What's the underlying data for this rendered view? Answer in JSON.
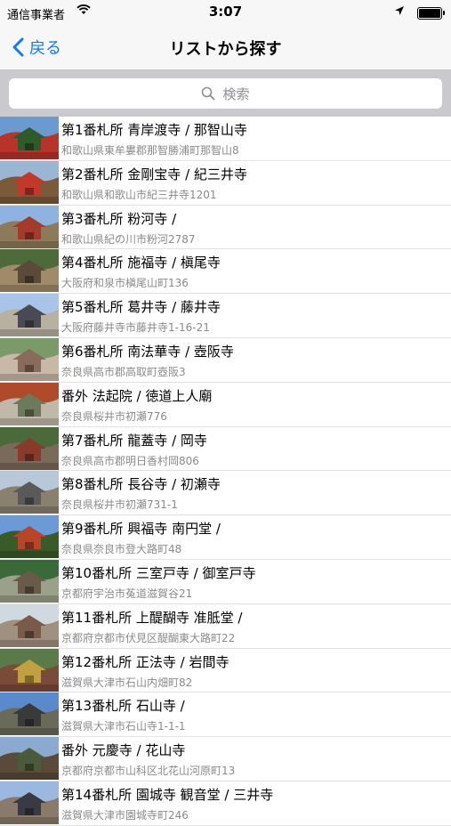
{
  "status_bar": {
    "carrier": "通信事業者",
    "time": "3:07"
  },
  "nav": {
    "back_label": "戻る",
    "title": "リストから探す"
  },
  "search": {
    "placeholder": "検索"
  },
  "colors": {
    "accent": "#0a7aff",
    "subtitle": "#8a8a8a",
    "search_bg": "#c9c9ce"
  },
  "temples": [
    {
      "name": "第1番札所 青岸渡寺 / 那智山寺",
      "address": "和歌山県東牟婁郡那智勝浦町那智山8",
      "thumb": [
        "#6a9bd0",
        "#2f5a2a",
        "#b8342a"
      ]
    },
    {
      "name": "第2番札所 金剛宝寺 / 紀三井寺",
      "address": "和歌山県和歌山市紀三井寺1201",
      "thumb": [
        "#9bb5d4",
        "#c0392b",
        "#7a5a3a"
      ]
    },
    {
      "name": "第3番札所 粉河寺 /",
      "address": "和歌山県紀の川市粉河2787",
      "thumb": [
        "#8fb3e0",
        "#a33b2c",
        "#8c7a5a"
      ]
    },
    {
      "name": "第4番札所 施福寺 / 槇尾寺",
      "address": "大阪府和泉市槇尾山町136",
      "thumb": [
        "#4d6b3a",
        "#5a4a3a",
        "#a08a6a"
      ]
    },
    {
      "name": "第5番札所 葛井寺 / 藤井寺",
      "address": "大阪府藤井寺市藤井寺1-16-21",
      "thumb": [
        "#a8c4e8",
        "#4a4a55",
        "#b8b0a0"
      ]
    },
    {
      "name": "第6番札所 南法華寺 / 壺阪寺",
      "address": "奈良県高市郡高取町壺阪3",
      "thumb": [
        "#7a9a6a",
        "#8a6a5a",
        "#c8b8a8"
      ]
    },
    {
      "name": "番外 法起院 / 徳道上人廟",
      "address": "奈良県桜井市初瀬776",
      "thumb": [
        "#b04a2a",
        "#6a7a5a",
        "#c0b8a8"
      ]
    },
    {
      "name": "第7番札所 龍蓋寺 / 岡寺",
      "address": "奈良県高市郡明日香村岡806",
      "thumb": [
        "#4a6a3a",
        "#8a3a2a",
        "#7a6a5a"
      ]
    },
    {
      "name": "第8番札所 長谷寺 / 初瀬寺",
      "address": "奈良県桜井市初瀬731-1",
      "thumb": [
        "#b8c8d8",
        "#5a5a5a",
        "#8a8070"
      ]
    },
    {
      "name": "第9番札所 興福寺 南円堂 /",
      "address": "奈良県奈良市登大路町48",
      "thumb": [
        "#6a9ad8",
        "#b8442a",
        "#3a5a2a"
      ]
    },
    {
      "name": "第10番札所 三室戸寺 / 御室戸寺",
      "address": "京都府宇治市菟道滋賀谷21",
      "thumb": [
        "#3a6a3a",
        "#6a5a4a",
        "#9aa08a"
      ]
    },
    {
      "name": "第11番札所 上醍醐寺 准胝堂 /",
      "address": "京都府京都市伏見区醍醐東大路町22",
      "thumb": [
        "#d0d8e0",
        "#7a5a4a",
        "#a09080"
      ]
    },
    {
      "name": "第12番札所 正法寺 / 岩間寺",
      "address": "滋賀県大津市石山内畑町82",
      "thumb": [
        "#5a7a4a",
        "#c0a040",
        "#7a4a3a"
      ]
    },
    {
      "name": "第13番札所 石山寺 /",
      "address": "滋賀県大津市石山寺1-1-1",
      "thumb": [
        "#5a8acb",
        "#3a3a3a",
        "#6a6a5a"
      ]
    },
    {
      "name": "番外 元慶寺 / 花山寺",
      "address": "京都府京都市山科区北花山河原町13",
      "thumb": [
        "#8aaad0",
        "#4a5a3a",
        "#5a4a3a"
      ]
    },
    {
      "name": "第14番札所 園城寺 観音堂 / 三井寺",
      "address": "滋賀県大津市園城寺町246",
      "thumb": [
        "#9ab8e0",
        "#3a3a45",
        "#8a7a6a"
      ]
    }
  ]
}
